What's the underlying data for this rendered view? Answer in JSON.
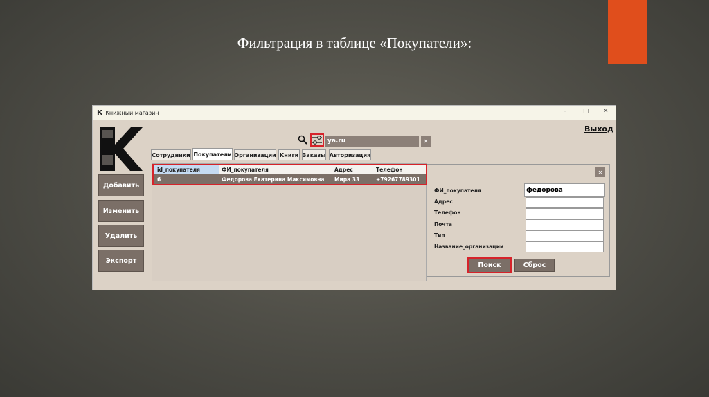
{
  "slide": {
    "title": "Фильтрация в таблице «Покупатели»:",
    "accent_color": "#e04e1c"
  },
  "window": {
    "title": "Книжный магазин",
    "logo_letter": "К",
    "minimize": "–",
    "maximize": "□",
    "close": "✕",
    "exit_link": "Выход"
  },
  "sidebar": {
    "buttons": [
      "Добавить",
      "Изменить",
      "Удалить",
      "Экспорт"
    ]
  },
  "search": {
    "value": "ya.ru",
    "clear": "✕",
    "search_icon": "magnifier-icon",
    "filter_icon": "sliders-icon"
  },
  "tabs": [
    "Сотрудники",
    "Покупатели",
    "Организации",
    "Книги",
    "Заказы",
    "Авторизация"
  ],
  "table": {
    "columns": [
      "id_покупателя",
      "ФИ_покупателя",
      "Адрес",
      "Телефон"
    ],
    "rows": [
      [
        "6",
        "Федорова Екатерина Максимовна",
        "Мира 33",
        "+79267789301"
      ]
    ]
  },
  "filter": {
    "close": "✕",
    "fields": [
      {
        "label": "ФИ_покупателя",
        "value": "федорова"
      },
      {
        "label": "Адрес",
        "value": ""
      },
      {
        "label": "Телефон",
        "value": ""
      },
      {
        "label": "Почта",
        "value": ""
      },
      {
        "label": "Тип",
        "value": ""
      },
      {
        "label": "Название_организации",
        "value": ""
      }
    ],
    "search_button": "Поиск",
    "reset_button": "Сброс"
  }
}
